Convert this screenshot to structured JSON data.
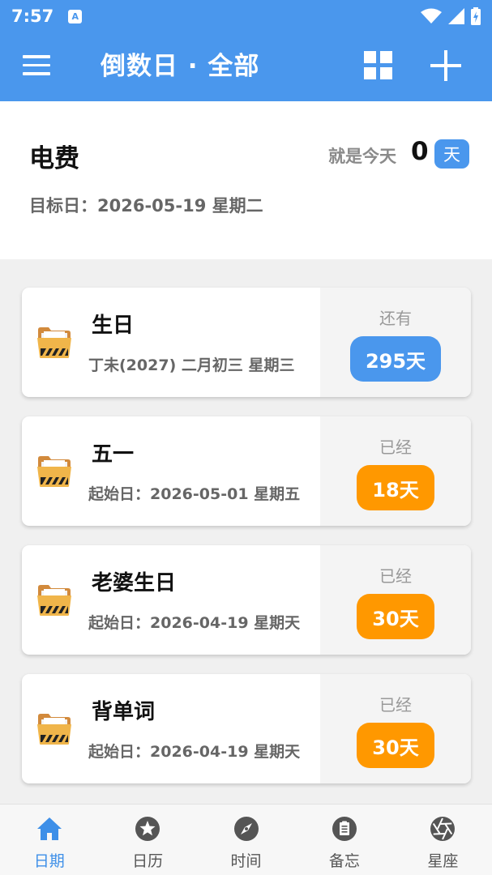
{
  "status_bar": {
    "time": "7:57",
    "notification_icon": "a-notification-icon",
    "right_icons": [
      "wifi-icon",
      "signal-icon",
      "battery-charging-icon"
    ]
  },
  "app_bar": {
    "title": "倒数日 · 全部",
    "menu_icon": "hamburger-menu-icon",
    "grid_icon": "grid-view-icon",
    "add_icon": "plus-icon"
  },
  "highlight": {
    "name": "电费",
    "today_label": "就是今天",
    "count": "0",
    "unit": "天",
    "target_date": "目标日：2026-05-19 星期二"
  },
  "events": [
    {
      "name": "生日",
      "subtitle": "丁未(2027) 二月初三 星期三",
      "status": "还有",
      "days": "295天",
      "color": "#4a97ed"
    },
    {
      "name": "五一",
      "subtitle": "起始日：2026-05-01 星期五",
      "status": "已经",
      "days": "18天",
      "color": "#ff9800"
    },
    {
      "name": "老婆生日",
      "subtitle": "起始日：2026-04-19 星期天",
      "status": "已经",
      "days": "30天",
      "color": "#ff9800"
    },
    {
      "name": "背单词",
      "subtitle": "起始日：2026-04-19 星期天",
      "status": "已经",
      "days": "30天",
      "color": "#ff9800"
    }
  ],
  "bottom_nav": {
    "active_color": "#3d8fe8",
    "tabs": [
      {
        "label": "日期",
        "icon": "home-icon",
        "active": true
      },
      {
        "label": "日历",
        "icon": "star-icon",
        "active": false
      },
      {
        "label": "时间",
        "icon": "compass-icon",
        "active": false
      },
      {
        "label": "备忘",
        "icon": "clipboard-icon",
        "active": false
      },
      {
        "label": "星座",
        "icon": "aperture-icon",
        "active": false
      }
    ]
  },
  "colors": {
    "primary": "#4a97ed",
    "orange": "#ff9800"
  }
}
